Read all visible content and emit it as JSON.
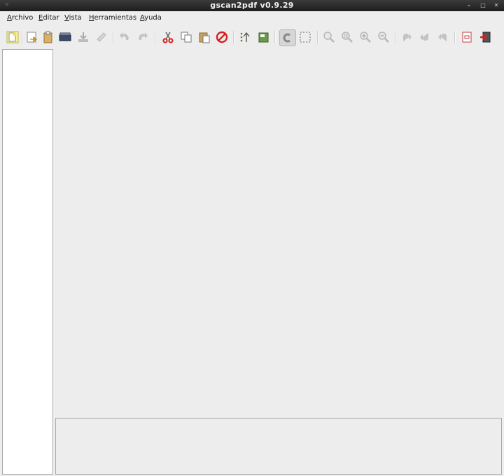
{
  "window": {
    "title": "gscan2pdf v0.9.29",
    "menu_glyph": "◦",
    "minimize_glyph": "–",
    "maximize_glyph": "□",
    "close_glyph": "✕"
  },
  "menubar": [
    {
      "label": "Archivo"
    },
    {
      "label": "Editar"
    },
    {
      "label": "Vista"
    },
    {
      "label": "Herramientas"
    },
    {
      "label": "Ayuda"
    }
  ],
  "toolbar": [
    {
      "icon": "new-document-icon",
      "enabled": true
    },
    {
      "icon": "open-file-icon",
      "enabled": true
    },
    {
      "icon": "paste-doc-icon",
      "enabled": true
    },
    {
      "icon": "scanner-icon",
      "enabled": true
    },
    {
      "icon": "save-icon",
      "enabled": false
    },
    {
      "icon": "email-icon",
      "enabled": false
    },
    {
      "icon": "undo-icon",
      "enabled": false
    },
    {
      "icon": "redo-icon",
      "enabled": false
    },
    {
      "icon": "cut-icon",
      "enabled": true
    },
    {
      "icon": "copy-icon",
      "enabled": true
    },
    {
      "icon": "paste-icon",
      "enabled": true
    },
    {
      "icon": "delete-icon",
      "enabled": true
    },
    {
      "icon": "renumber-icon",
      "enabled": true
    },
    {
      "icon": "select-all-icon",
      "enabled": true
    },
    {
      "icon": "drag-tool-icon",
      "enabled": true
    },
    {
      "icon": "rectangle-select-icon",
      "enabled": true
    },
    {
      "icon": "zoom-100-icon",
      "enabled": false
    },
    {
      "icon": "zoom-fit-icon",
      "enabled": false
    },
    {
      "icon": "zoom-in-icon",
      "enabled": false
    },
    {
      "icon": "zoom-out-icon",
      "enabled": false
    },
    {
      "icon": "rotate-90-icon",
      "enabled": false
    },
    {
      "icon": "rotate-180-icon",
      "enabled": false
    },
    {
      "icon": "rotate-270-icon",
      "enabled": false
    },
    {
      "icon": "properties-icon",
      "enabled": true
    },
    {
      "icon": "quit-icon",
      "enabled": true
    }
  ],
  "colors": {
    "background": "#ededed",
    "titlebar": "#2b2b2b",
    "delete_red": "#d42020",
    "accent_green": "#4a8a2a"
  }
}
